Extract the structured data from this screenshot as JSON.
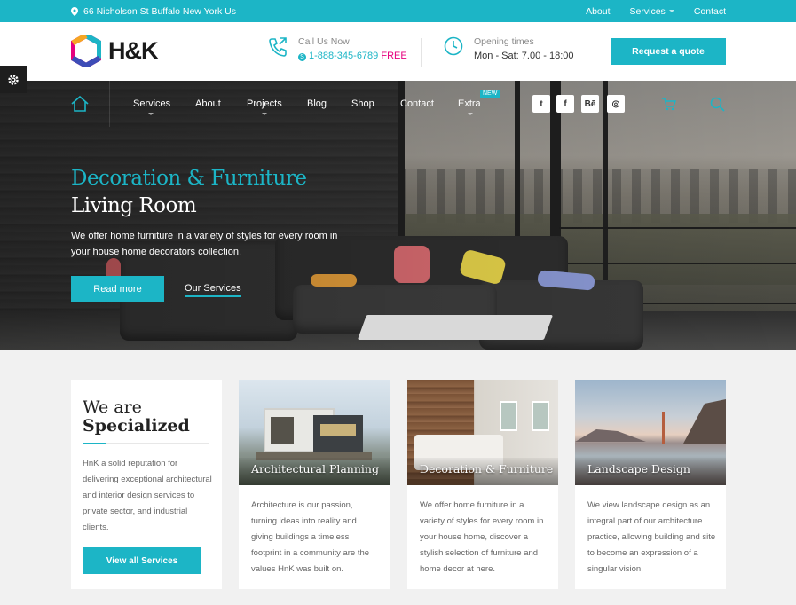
{
  "topbar": {
    "address": "66 Nicholson St Buffalo New York Us",
    "links": [
      "About",
      "Services",
      "Contact"
    ]
  },
  "header": {
    "brand": "H&K",
    "call_label": "Call Us Now",
    "phone": "1-888-345-6789",
    "phone_suffix": "FREE",
    "hours_label": "Opening times",
    "hours": "Mon - Sat: 7.00 - 18:00",
    "quote_button": "Request a quote"
  },
  "nav": {
    "items": [
      "Services",
      "About",
      "Projects",
      "Blog",
      "Shop",
      "Contact",
      "Extra"
    ],
    "badge": "NEW",
    "social": [
      "twitter-icon",
      "facebook-icon",
      "behance-icon",
      "dribbble-icon"
    ],
    "social_glyphs": [
      "t",
      "f",
      "Bē",
      "◎"
    ]
  },
  "hero": {
    "title_accent": "Decoration & Furniture",
    "title": "Living Room",
    "text": "We offer home furniture in a variety of styles for every room in your house home decorators collection.",
    "primary_button": "Read more",
    "secondary_link": "Our Services"
  },
  "intro": {
    "line1": "We are",
    "line2": "Specialized",
    "text": "HnK a solid reputation for delivering exceptional architectural and interior design services to private sector, and industrial clients.",
    "button": "View all Services"
  },
  "services": [
    {
      "title": "Architectural Planning",
      "text": "Architecture is our passion, turning ideas into reality and giving buildings a timeless footprint in a community are the values HnK was built on."
    },
    {
      "title": "Decoration & Furniture",
      "text": "We offer home furniture in a variety of styles for every room in your house home, discover a stylish selection of furniture and home decor at here."
    },
    {
      "title": "Landscape Design",
      "text": "We view landscape design as an integral part of our architecture practice, allowing building and site to become an expression of a singular vision."
    }
  ],
  "colors": {
    "accent": "#1cb5c6",
    "phone_free": "#e6007e"
  }
}
